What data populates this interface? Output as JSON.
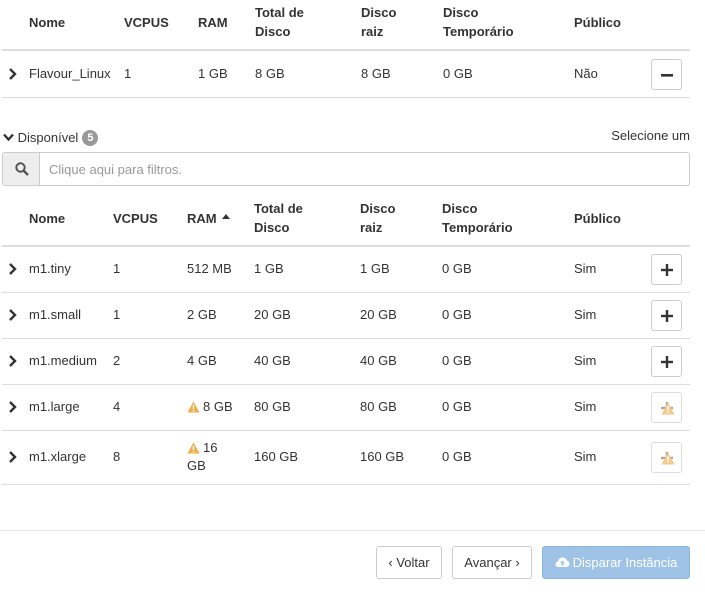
{
  "columns": {
    "name": "Nome",
    "vcpus": "VCPUS",
    "ram": "RAM",
    "total_disk_1": "Total de",
    "total_disk_2": "Disco",
    "root_disk_1": "Disco",
    "root_disk_2": "raiz",
    "temp_disk_1": "Disco",
    "temp_disk_2": "Temporário",
    "public": "Público"
  },
  "allocated": {
    "rows": [
      {
        "name": "Flavour_Linux",
        "vcpus": "1",
        "ram": "1 GB",
        "total_disk": "8 GB",
        "root_disk": "8 GB",
        "temp_disk": "0 GB",
        "public": "Não"
      }
    ]
  },
  "available": {
    "label": "Disponível",
    "count": "5",
    "select_hint": "Selecione um",
    "search_placeholder": "Clique aqui para filtros.",
    "rows": [
      {
        "name": "m1.tiny",
        "vcpus": "1",
        "ram": "512 MB",
        "total_disk": "1 GB",
        "root_disk": "1 GB",
        "temp_disk": "0 GB",
        "public": "Sim",
        "warning": false
      },
      {
        "name": "m1.small",
        "vcpus": "1",
        "ram": "2 GB",
        "total_disk": "20 GB",
        "root_disk": "20 GB",
        "temp_disk": "0 GB",
        "public": "Sim",
        "warning": false
      },
      {
        "name": "m1.medium",
        "vcpus": "2",
        "ram": "4 GB",
        "total_disk": "40 GB",
        "root_disk": "40 GB",
        "temp_disk": "0 GB",
        "public": "Sim",
        "warning": false
      },
      {
        "name": "m1.large",
        "vcpus": "4",
        "ram": "8 GB",
        "total_disk": "80 GB",
        "root_disk": "80 GB",
        "temp_disk": "0 GB",
        "public": "Sim",
        "warning": true
      },
      {
        "name": "m1.xlarge",
        "vcpus": "8",
        "ram_1": "16",
        "ram_2": "GB",
        "total_disk": "160 GB",
        "root_disk": "160 GB",
        "temp_disk": "0 GB",
        "public": "Sim",
        "warning": true
      }
    ]
  },
  "footer": {
    "back_label": "‹ Voltar",
    "next_label": "Avançar ›",
    "launch_label": "Disparar Instância"
  },
  "icons": {
    "expand": "chevron-right-icon",
    "remove": "minus-icon",
    "add": "plus-icon",
    "warning": "warning-icon",
    "search": "search-icon",
    "collapse": "chevron-down-icon",
    "launch": "cloud-upload-icon",
    "sort": "sort-up-icon"
  },
  "colors": {
    "warning": "#f0ad4e",
    "primary_disabled": "#9ec3e6",
    "badge": "#999999"
  }
}
